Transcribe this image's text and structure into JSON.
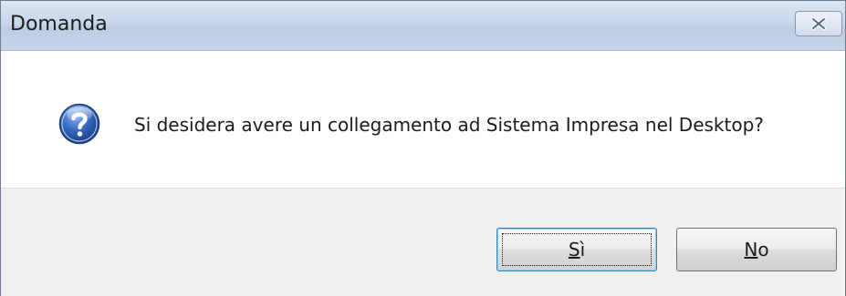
{
  "dialog": {
    "title": "Domanda",
    "message": "Si desidera avere un collegamento ad Sistema Impresa nel Desktop?",
    "icon": "question-icon",
    "buttons": {
      "yes": {
        "mnemonic": "S",
        "rest": "ì"
      },
      "no": {
        "mnemonic": "N",
        "rest": "o"
      }
    }
  },
  "colors": {
    "titlebar": "#c8d7ea",
    "footer": "#f0f0f0",
    "focus_border": "#3c7fb1",
    "icon_blue": "#2f62b8"
  }
}
